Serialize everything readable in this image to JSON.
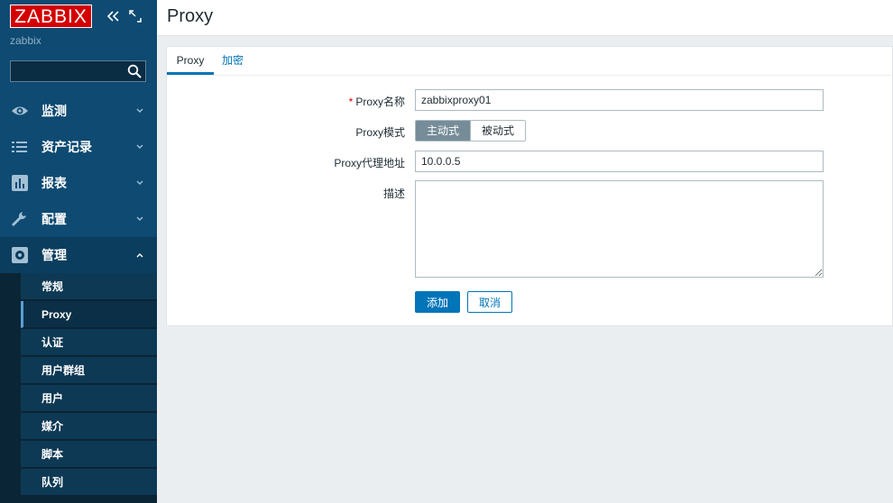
{
  "brand": {
    "logo_text": "ZABBIX",
    "server_name": "zabbix",
    "logo_color": "#d40000"
  },
  "sidebar": {
    "search_value": "",
    "menu": [
      {
        "label": "监测",
        "icon": "eye-icon"
      },
      {
        "label": "资产记录",
        "icon": "list-icon"
      },
      {
        "label": "报表",
        "icon": "bar-chart-icon"
      },
      {
        "label": "配置",
        "icon": "wrench-icon"
      },
      {
        "label": "管理",
        "icon": "gear-icon"
      }
    ],
    "submenu": [
      "常规",
      "Proxy",
      "认证",
      "用户群组",
      "用户",
      "媒介",
      "脚本",
      "队列"
    ],
    "selected_submenu": "Proxy"
  },
  "header": {
    "title": "Proxy"
  },
  "tabs": [
    "Proxy",
    "加密"
  ],
  "form": {
    "name_label": "Proxy名称",
    "required_mark": "*",
    "name_value": "zabbixproxy01",
    "mode_label": "Proxy模式",
    "mode_active": "主动式",
    "mode_passive": "被动式",
    "address_label": "Proxy代理地址",
    "address_value": "10.0.0.5",
    "description_label": "描述",
    "description_value": "",
    "add_button": "添加",
    "cancel_button": "取消"
  },
  "colors": {
    "sidebar": "#0e4a72",
    "accent": "#0275b8"
  }
}
